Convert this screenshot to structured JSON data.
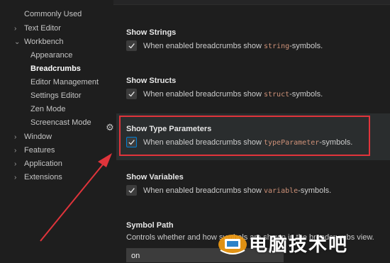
{
  "sidebar": {
    "items": [
      {
        "label": "Commonly Used",
        "chevron": ""
      },
      {
        "label": "Text Editor",
        "chevron": "›"
      },
      {
        "label": "Workbench",
        "chevron": "⌄"
      },
      {
        "label": "Appearance",
        "chevron": ""
      },
      {
        "label": "Breadcrumbs",
        "chevron": ""
      },
      {
        "label": "Editor Management",
        "chevron": ""
      },
      {
        "label": "Settings Editor",
        "chevron": ""
      },
      {
        "label": "Zen Mode",
        "chevron": ""
      },
      {
        "label": "Screencast Mode",
        "chevron": ""
      },
      {
        "label": "Window",
        "chevron": "›"
      },
      {
        "label": "Features",
        "chevron": "›"
      },
      {
        "label": "Application",
        "chevron": "›"
      },
      {
        "label": "Extensions",
        "chevron": "›"
      }
    ]
  },
  "settings": [
    {
      "title": "Show Strings",
      "pre": "When enabled breadcrumbs show ",
      "code": "string",
      "post": "-symbols.",
      "checked": true
    },
    {
      "title": "Show Structs",
      "pre": "When enabled breadcrumbs show ",
      "code": "struct",
      "post": "-symbols.",
      "checked": true
    },
    {
      "title": "Show Type Parameters",
      "pre": "When enabled breadcrumbs show ",
      "code": "typeParameter",
      "post": "-symbols.",
      "checked": true
    },
    {
      "title": "Show Variables",
      "pre": "When enabled breadcrumbs show ",
      "code": "variable",
      "post": "-symbols.",
      "checked": true
    }
  ],
  "symbol_path": {
    "title": "Symbol Path",
    "description": "Controls whether and how symbols are shown in the breadcrumbs view.",
    "value": "on"
  },
  "watermark": {
    "text": "电脑技术吧"
  },
  "colors": {
    "accent": "#007fd4",
    "highlight": "#e0343b",
    "code": "#ce9178"
  }
}
